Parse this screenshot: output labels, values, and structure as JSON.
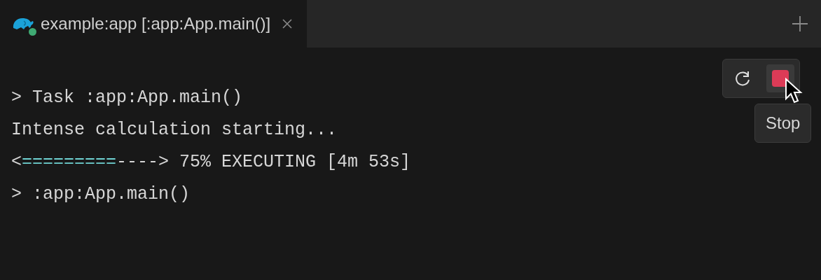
{
  "tabs": [
    {
      "title": "example:app [:app:App.main()]",
      "selected": true,
      "running": true
    }
  ],
  "toolbar": {
    "buttons": [
      {
        "kind": "rerun",
        "hovered": false
      },
      {
        "kind": "stop",
        "hovered": true
      }
    ],
    "tooltip": "Stop"
  },
  "console": {
    "lines": [
      {
        "kind": "text",
        "text": "> Task :app:App.main()"
      },
      {
        "kind": "text",
        "text": "Intense calculation starting..."
      },
      {
        "kind": "progress",
        "start": "<",
        "done": "=========",
        "todo": "---->",
        "status": " 75% EXECUTING [4m 53s]"
      },
      {
        "kind": "text",
        "text": "> :app:App.main()"
      }
    ]
  }
}
